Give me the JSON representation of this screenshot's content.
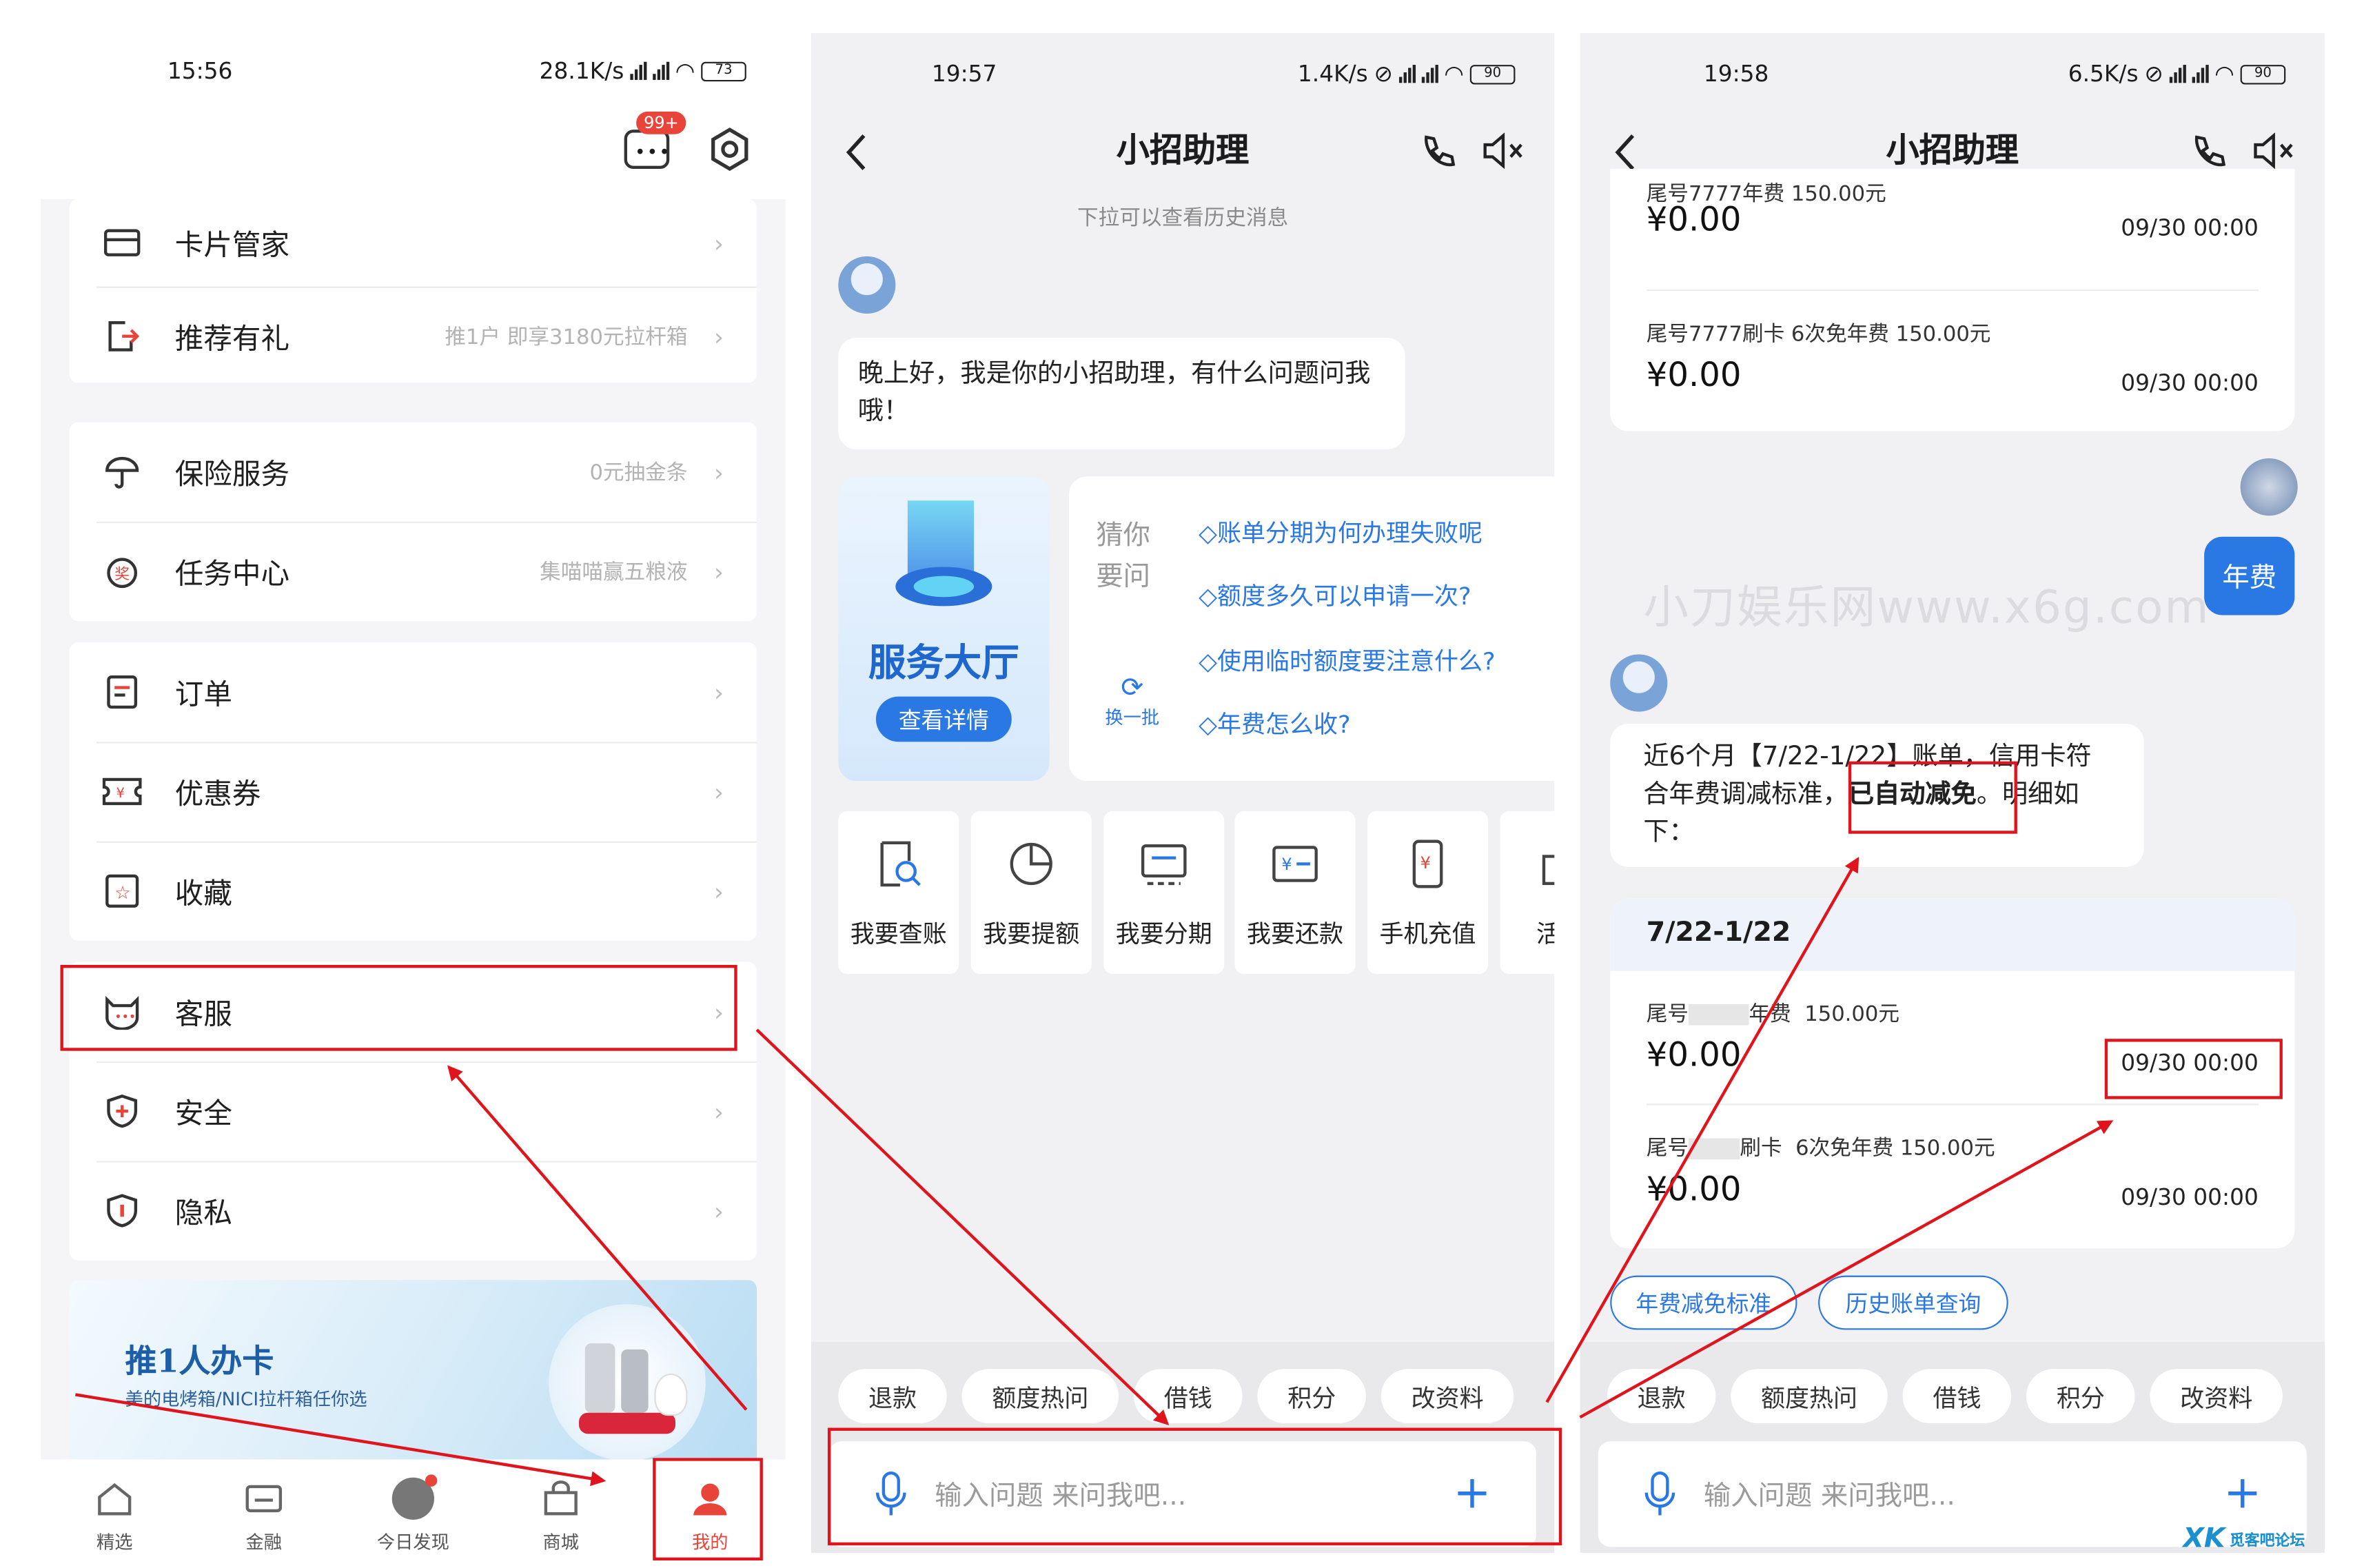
{
  "colors": {
    "accent": "#2a78e4",
    "annotation": "#e0141c",
    "brand": "#e8443a"
  },
  "p1": {
    "status": {
      "time": "15:56",
      "speed": "28.1K/s",
      "battery": "73"
    },
    "msg_badge": "99+",
    "menu": [
      {
        "label": "卡片管家",
        "sub": "",
        "icon": "card-icon"
      },
      {
        "label": "推荐有礼",
        "sub": "推1户 即享3180元拉杆箱",
        "icon": "share-icon"
      },
      {
        "label": "保险服务",
        "sub": "0元抽金条",
        "icon": "umbrella-icon"
      },
      {
        "label": "任务中心",
        "sub": "集喵喵赢五粮液",
        "icon": "task-icon"
      },
      {
        "label": "订单",
        "sub": "",
        "icon": "order-icon"
      },
      {
        "label": "优惠券",
        "sub": "",
        "icon": "coupon-icon"
      },
      {
        "label": "收藏",
        "sub": "",
        "icon": "star-icon"
      },
      {
        "label": "客服",
        "sub": "",
        "icon": "service-icon"
      },
      {
        "label": "安全",
        "sub": "",
        "icon": "shield-icon"
      },
      {
        "label": "隐私",
        "sub": "",
        "icon": "privacy-icon"
      }
    ],
    "chev": "›",
    "banner": {
      "title": "推1人办卡",
      "subtitle": "美的电烤箱/NICI拉杆箱任你选"
    },
    "tabs": [
      {
        "label": "精选",
        "icon": "home-icon"
      },
      {
        "label": "金融",
        "icon": "finance-icon"
      },
      {
        "label": "今日发现",
        "icon": "discover-icon"
      },
      {
        "label": "商城",
        "icon": "mall-icon"
      },
      {
        "label": "我的",
        "icon": "me-icon"
      }
    ]
  },
  "p2": {
    "status": {
      "time": "19:57",
      "speed": "1.4K/s",
      "battery": "90"
    },
    "title": "小招助理",
    "history_hint": "下拉可以查看历史消息",
    "greeting": "晚上好，我是你的小招助理，有什么问题问我哦！",
    "hall": {
      "title": "服务大厅",
      "button": "查看详情"
    },
    "guess": {
      "label_line1": "猜你",
      "label_line2": "要问",
      "refresh": "换一批",
      "questions": [
        "◇账单分期为何办理失败呢",
        "◇额度多久可以申请一次?",
        "◇使用临时额度要注意什么?",
        "◇年费怎么收?"
      ]
    },
    "services": [
      {
        "label": "我要查账",
        "icon": "bill-icon"
      },
      {
        "label": "我要提额",
        "icon": "pie-icon"
      },
      {
        "label": "我要分期",
        "icon": "installment-icon"
      },
      {
        "label": "我要还款",
        "icon": "repay-icon"
      },
      {
        "label": "手机充值",
        "icon": "phone-recharge-icon"
      },
      {
        "label": "活动",
        "icon": "gift-icon"
      }
    ],
    "quick": [
      "退款",
      "额度热问",
      "借钱",
      "积分",
      "改资料"
    ],
    "input_placeholder": "输入问题 来问我吧..."
  },
  "p3": {
    "status": {
      "time": "19:58",
      "speed": "6.5K/s",
      "battery": "90"
    },
    "title": "小招助理",
    "top_bill": [
      {
        "text": "尾号7777年费  150.00元",
        "amount": "¥0.00",
        "date": "09/30 00:00"
      },
      {
        "text": "尾号7777刷卡  6次免年费  150.00元",
        "amount": "¥0.00",
        "date": "09/30 00:00"
      }
    ],
    "user_msg": "年费",
    "watermark": "小刀娱乐网www.x6g.com",
    "reply_before": "近6个月【7/22-1/22】账单，信用卡符合年费调减标准，",
    "reply_highlight": "已自动减免",
    "reply_after": "。明细如下：",
    "period": "7/22-1/22",
    "detail": [
      {
        "prefix": "尾号",
        "suffix": "年费",
        "fee": "150.00元",
        "amount": "¥0.00",
        "date": "09/30 00:00"
      },
      {
        "prefix": "尾号",
        "suffix": "刷卡",
        "fee": "6次免年费  150.00元",
        "amount": "¥0.00",
        "date": "09/30 00:00"
      }
    ],
    "chips": [
      "年费减免标准",
      "历史账单查询"
    ],
    "quick": [
      "退款",
      "额度热问",
      "借钱",
      "积分",
      "改资料"
    ],
    "input_placeholder": "输入问题 来问我吧..."
  },
  "site_logo": "觅客吧论坛"
}
